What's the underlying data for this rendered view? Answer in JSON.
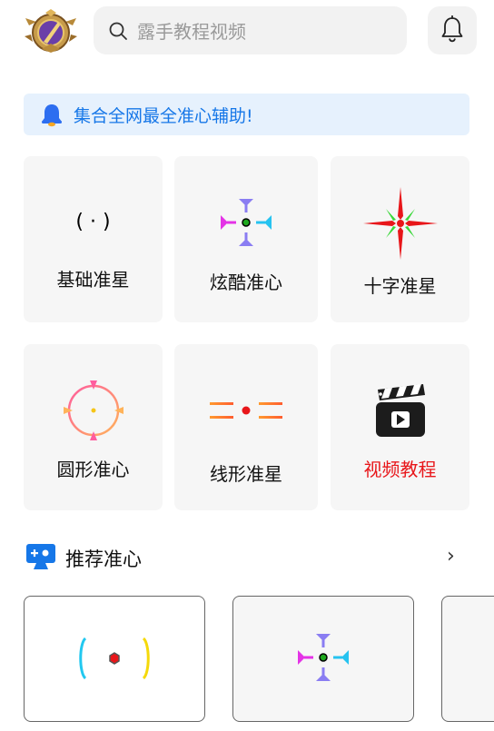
{
  "header": {
    "search_placeholder": "露手教程视频",
    "logo_icon": "rank-badge-icon",
    "bell_icon": "bell-icon"
  },
  "notice": {
    "text": "集合全网最全准心辅助!"
  },
  "grid": {
    "items": [
      {
        "label": "基础准星",
        "icon": "basic-crosshair-icon"
      },
      {
        "label": "炫酷准心",
        "icon": "cool-crosshair-icon"
      },
      {
        "label": "十字准星",
        "icon": "cross-crosshair-icon"
      },
      {
        "label": "圆形准心",
        "icon": "circle-crosshair-icon"
      },
      {
        "label": "线形准星",
        "icon": "line-crosshair-icon"
      },
      {
        "label": "视频教程",
        "icon": "video-clapper-icon"
      }
    ],
    "basic_glyph": "( · )"
  },
  "recommend": {
    "title": "推荐准心",
    "more": "›"
  },
  "colors": {
    "accent_blue": "#1677e8",
    "notice_bg": "#e6f1fd",
    "video_red": "#e8161a"
  }
}
